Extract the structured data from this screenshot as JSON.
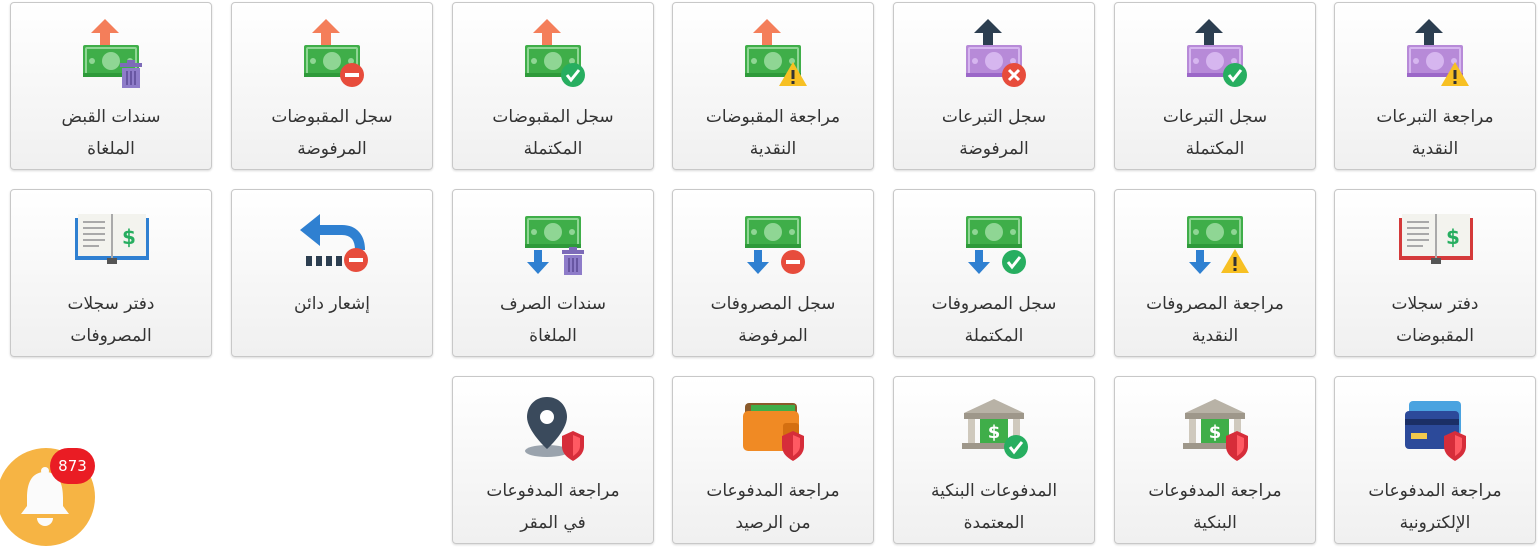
{
  "tiles": [
    {
      "id": "donations-cash-review",
      "lines": [
        "مراجعة التبرعات",
        "النقدية"
      ]
    },
    {
      "id": "donations-completed-log",
      "lines": [
        "سجل التبرعات",
        "المكتملة"
      ]
    },
    {
      "id": "donations-rejected-log",
      "lines": [
        "سجل التبرعات",
        "المرفوضة"
      ]
    },
    {
      "id": "receipts-cash-review",
      "lines": [
        "مراجعة المقبوضات",
        "النقدية"
      ]
    },
    {
      "id": "receipts-completed-log",
      "lines": [
        "سجل المقبوضات",
        "المكتملة"
      ]
    },
    {
      "id": "receipts-rejected-log",
      "lines": [
        "سجل المقبوضات",
        "المرفوضة"
      ]
    },
    {
      "id": "cancelled-receipt-vouchers",
      "lines": [
        "سندات القبض",
        "الملغاة"
      ]
    },
    {
      "id": "receipts-ledger",
      "lines": [
        "دفتر سجلات",
        "المقبوضات"
      ]
    },
    {
      "id": "expenses-cash-review",
      "lines": [
        "مراجعة المصروفات",
        "النقدية"
      ]
    },
    {
      "id": "expenses-completed-log",
      "lines": [
        "سجل المصروفات",
        "المكتملة"
      ]
    },
    {
      "id": "expenses-rejected-log",
      "lines": [
        "سجل المصروفات",
        "المرفوضة"
      ]
    },
    {
      "id": "cancelled-payment-vouchers",
      "lines": [
        "سندات الصرف",
        "الملغاة"
      ]
    },
    {
      "id": "credit-notice",
      "lines": [
        "إشعار دائن"
      ]
    },
    {
      "id": "expenses-ledger",
      "lines": [
        "دفتر سجلات",
        "المصروفات"
      ]
    },
    {
      "id": "electronic-payments-review",
      "lines": [
        "مراجعة المدفوعات",
        "الإلكترونية"
      ]
    },
    {
      "id": "bank-payments-review",
      "lines": [
        "مراجعة المدفوعات",
        "البنكية"
      ]
    },
    {
      "id": "approved-bank-payments",
      "lines": [
        "المدفوعات البنكية",
        "المعتمدة"
      ]
    },
    {
      "id": "balance-payments-review",
      "lines": [
        "مراجعة المدفوعات",
        "من الرصيد"
      ]
    },
    {
      "id": "onsite-payments-review",
      "lines": [
        "مراجعة المدفوعات",
        "في المقر"
      ]
    }
  ],
  "icons": [
    "money-up-purple-warning-icon",
    "money-up-purple-check-icon",
    "money-up-purple-x-icon",
    "money-up-orange-warning-icon",
    "money-up-orange-check-icon",
    "money-up-orange-minus-icon",
    "money-up-orange-trash-icon",
    "ledger-book-red-icon",
    "money-down-warning-icon",
    "money-down-check-icon",
    "money-down-minus-icon",
    "money-down-trash-icon",
    "return-arrow-minus-icon",
    "ledger-book-blue-icon",
    "credit-card-shield-icon",
    "bank-shield-icon",
    "bank-check-icon",
    "wallet-shield-icon",
    "location-pin-shield-icon"
  ],
  "notifications": {
    "count": "873"
  },
  "colors": {
    "money_green": "#3fae49",
    "money_purple": "#b78ad8",
    "arrow_orange": "#f47e5a",
    "arrow_navy": "#2c3e50",
    "arrow_blue": "#2f80d1",
    "badge_red": "#ea1c24",
    "bell_circle": "#f6b444"
  }
}
